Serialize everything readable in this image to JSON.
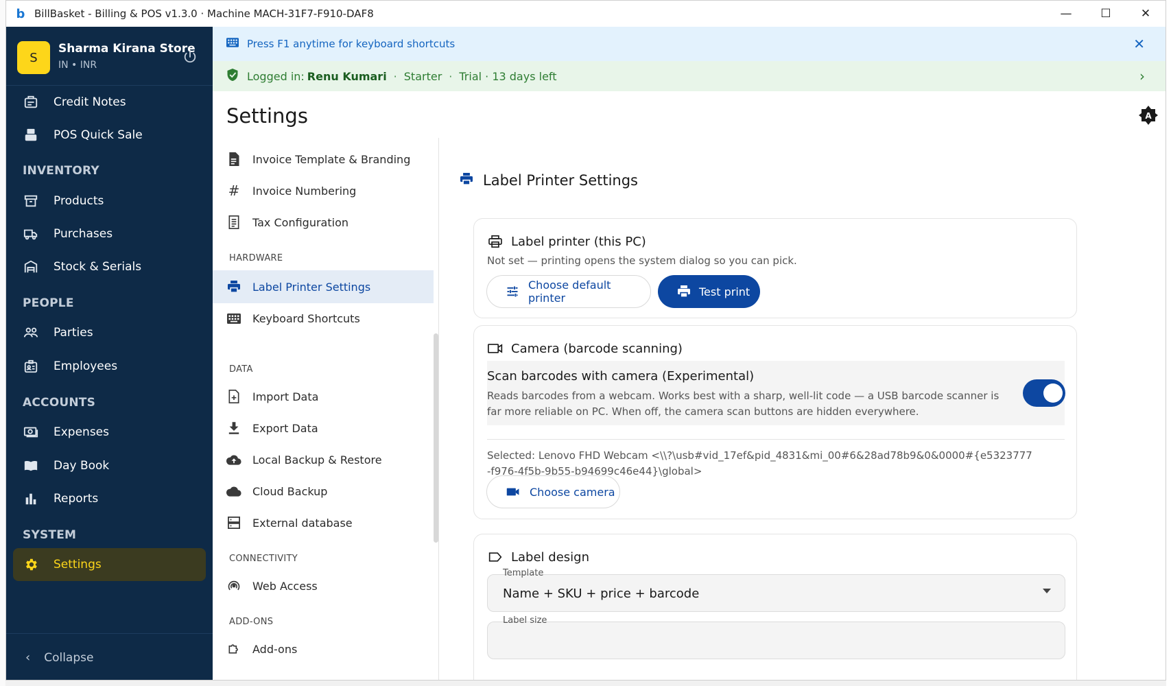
{
  "app": {
    "title": "BillBasket - Billing & POS  v1.3.0  ·  Machine MACH-31F7-F910-DAF8"
  },
  "store": {
    "avatar_letter": "S",
    "name": "Sharma Kirana Store",
    "locale": "IN • INR"
  },
  "sidebar": {
    "items": [
      {
        "label": "Credit Notes",
        "icon": "credit-notes-icon"
      },
      {
        "label": "POS Quick Sale",
        "icon": "pos-icon"
      },
      {
        "label": "Products",
        "icon": "archive-icon"
      },
      {
        "label": "Purchases",
        "icon": "truck-icon"
      },
      {
        "label": "Stock & Serials",
        "icon": "warehouse-icon"
      },
      {
        "label": "Parties",
        "icon": "people-icon"
      },
      {
        "label": "Employees",
        "icon": "badge-icon"
      },
      {
        "label": "Expenses",
        "icon": "money-icon"
      },
      {
        "label": "Day Book",
        "icon": "book-icon"
      },
      {
        "label": "Reports",
        "icon": "bar-chart-icon"
      },
      {
        "label": "Settings",
        "icon": "gear-icon",
        "active": true
      }
    ],
    "sections": {
      "inventory": "INVENTORY",
      "people": "PEOPLE",
      "accounts": "ACCOUNTS",
      "system": "SYSTEM"
    },
    "collapse_label": "Collapse"
  },
  "banners": {
    "shortcut_hint": "Press F1 anytime for keyboard shortcuts",
    "logged_in_prefix": "Logged in:",
    "user": "Renu Kumari",
    "plan": "Starter",
    "trial": "Trial · 13 days left"
  },
  "page": {
    "title": "Settings"
  },
  "settings_nav": {
    "items": [
      {
        "label": "Invoice Template & Branding"
      },
      {
        "label": "Invoice Numbering"
      },
      {
        "label": "Tax Configuration"
      },
      {
        "label": "Label Printer Settings",
        "active": true
      },
      {
        "label": "Keyboard Shortcuts"
      },
      {
        "label": "Import Data"
      },
      {
        "label": "Export Data"
      },
      {
        "label": "Local Backup & Restore"
      },
      {
        "label": "Cloud Backup"
      },
      {
        "label": "External database"
      },
      {
        "label": "Web Access"
      },
      {
        "label": "Add-ons"
      }
    ],
    "sections": {
      "hardware": "HARDWARE",
      "data": "DATA",
      "connectivity": "CONNECTIVITY",
      "addons": "ADD-ONS"
    }
  },
  "content": {
    "heading": "Label Printer Settings",
    "printer_card": {
      "title": "Label printer (this PC)",
      "description": "Not set — printing opens the system dialog so you can pick.",
      "choose_label": "Choose default printer",
      "test_label": "Test print"
    },
    "camera_card": {
      "title": "Camera (barcode scanning)",
      "toggle_title": "Scan barcodes with camera (Experimental)",
      "toggle_desc": "Reads barcodes from a webcam. Works best with a sharp, well-lit code — a USB barcode scanner is far more reliable on PC. When off, the camera scan buttons are hidden everywhere.",
      "toggle_on": true,
      "selected": "Selected: Lenovo FHD Webcam <\\\\?\\usb#vid_17ef&pid_4831&mi_00#6&28ad78b9&0&0000#{e5323777-f976-4f5b-9b55-b94699c46e44}\\global>",
      "choose_camera_label": "Choose camera"
    },
    "design_card": {
      "title": "Label design",
      "template_label": "Template",
      "template_value": "Name + SKU + price + barcode",
      "size_label": "Label size"
    }
  },
  "colors": {
    "sidebar_bg": "#0e2a47",
    "accent": "#0d47a1",
    "active_yellow": "#fdd61a"
  }
}
